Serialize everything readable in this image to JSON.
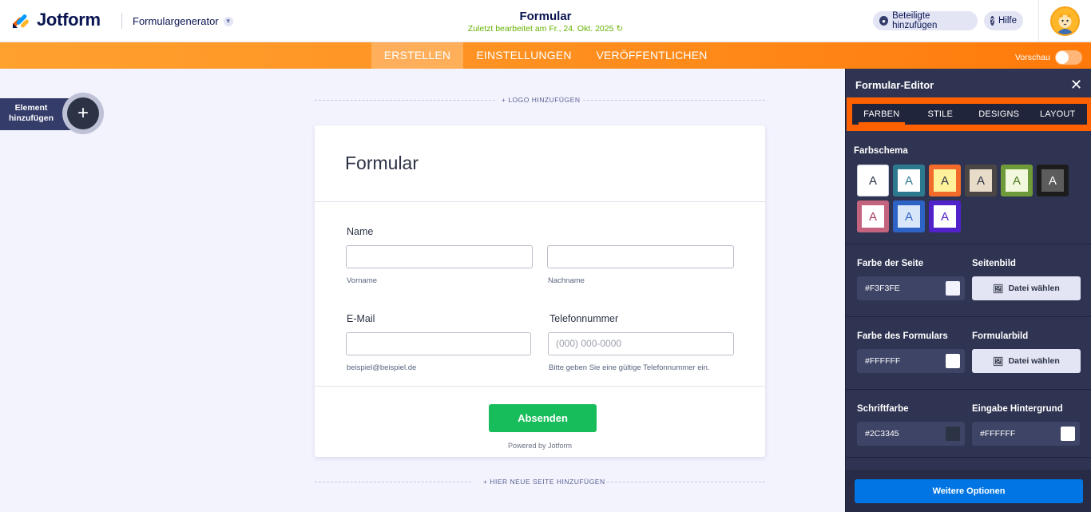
{
  "header": {
    "logo_text": "Jotform",
    "generator_label": "Formulargenerator",
    "form_title": "Formular",
    "last_edited": "Zuletzt bearbeitet am Fr., 24. Okt. 2025",
    "add_participants": "Beteiligte hinzufügen",
    "help": "Hilfe"
  },
  "nav": {
    "tabs": [
      "ERSTELLEN",
      "EINSTELLUNGEN",
      "VERÖFFENTLICHEN"
    ],
    "active_tab": "ERSTELLEN",
    "preview_label": "Vorschau"
  },
  "sidebar": {
    "add_element": "Element hinzufügen",
    "add_icon": "+"
  },
  "canvas": {
    "add_logo": "+ LOGO HINZUFÜGEN",
    "add_page": "+ HIER NEUE SEITE HINZUFÜGEN"
  },
  "form": {
    "heading": "Formular",
    "name_label": "Name",
    "first_name_sub": "Vorname",
    "last_name_sub": "Nachname",
    "email_label": "E-Mail",
    "email_sub": "beispiel@beispiel.de",
    "phone_label": "Telefonnummer",
    "phone_placeholder": "(000) 000-0000",
    "phone_sub": "Bitte geben Sie eine gültige Telefonnummer ein.",
    "submit": "Absenden",
    "powered": "Powered by Jotform"
  },
  "panel": {
    "title": "Formular-Editor",
    "tabs": [
      "FARBEN",
      "STILE",
      "DESIGNS",
      "LAYOUT"
    ],
    "active_tab": "FARBEN",
    "scheme_title": "Farbschema",
    "swatch_letter": "A",
    "swatches": [
      {
        "outer": "#FFFFFF",
        "inner": "#FFFFFF",
        "text": "#2C3345"
      },
      {
        "outer": "#2D7A8E",
        "inner": "#FFFFFF",
        "text": "#2D7A8E"
      },
      {
        "outer": "#F26B2B",
        "inner": "#FFF29A",
        "text": "#2C3345"
      },
      {
        "outer": "#4B4646",
        "inner": "#E8DCC8",
        "text": "#2C3345"
      },
      {
        "outer": "#6E9A3A",
        "inner": "#F2F8DE",
        "text": "#4E7A20"
      },
      {
        "outer": "#1C1C1C",
        "inner": "#5C5C5C",
        "text": "#FFFFFF"
      },
      {
        "outer": "#C4637E",
        "inner": "#FFFFFF",
        "text": "#A93A5C"
      },
      {
        "outer": "#2E63C6",
        "inner": "#D8E6FA",
        "text": "#2E63C6"
      },
      {
        "outer": "#5122C9",
        "inner": "#FFFFFF",
        "text": "#5122C9"
      }
    ],
    "page_color_label": "Farbe der Seite",
    "page_color_value": "#F3F3FE",
    "page_image_label": "Seitenbild",
    "choose_file": "Datei wählen",
    "form_color_label": "Farbe des Formulars",
    "form_color_value": "#FFFFFF",
    "form_image_label": "Formularbild",
    "font_color_label": "Schriftfarbe",
    "font_color_value": "#2C3345",
    "input_bg_label": "Eingabe Hintergrund",
    "input_bg_value": "#FFFFFF",
    "more_options": "Weitere Optionen"
  }
}
